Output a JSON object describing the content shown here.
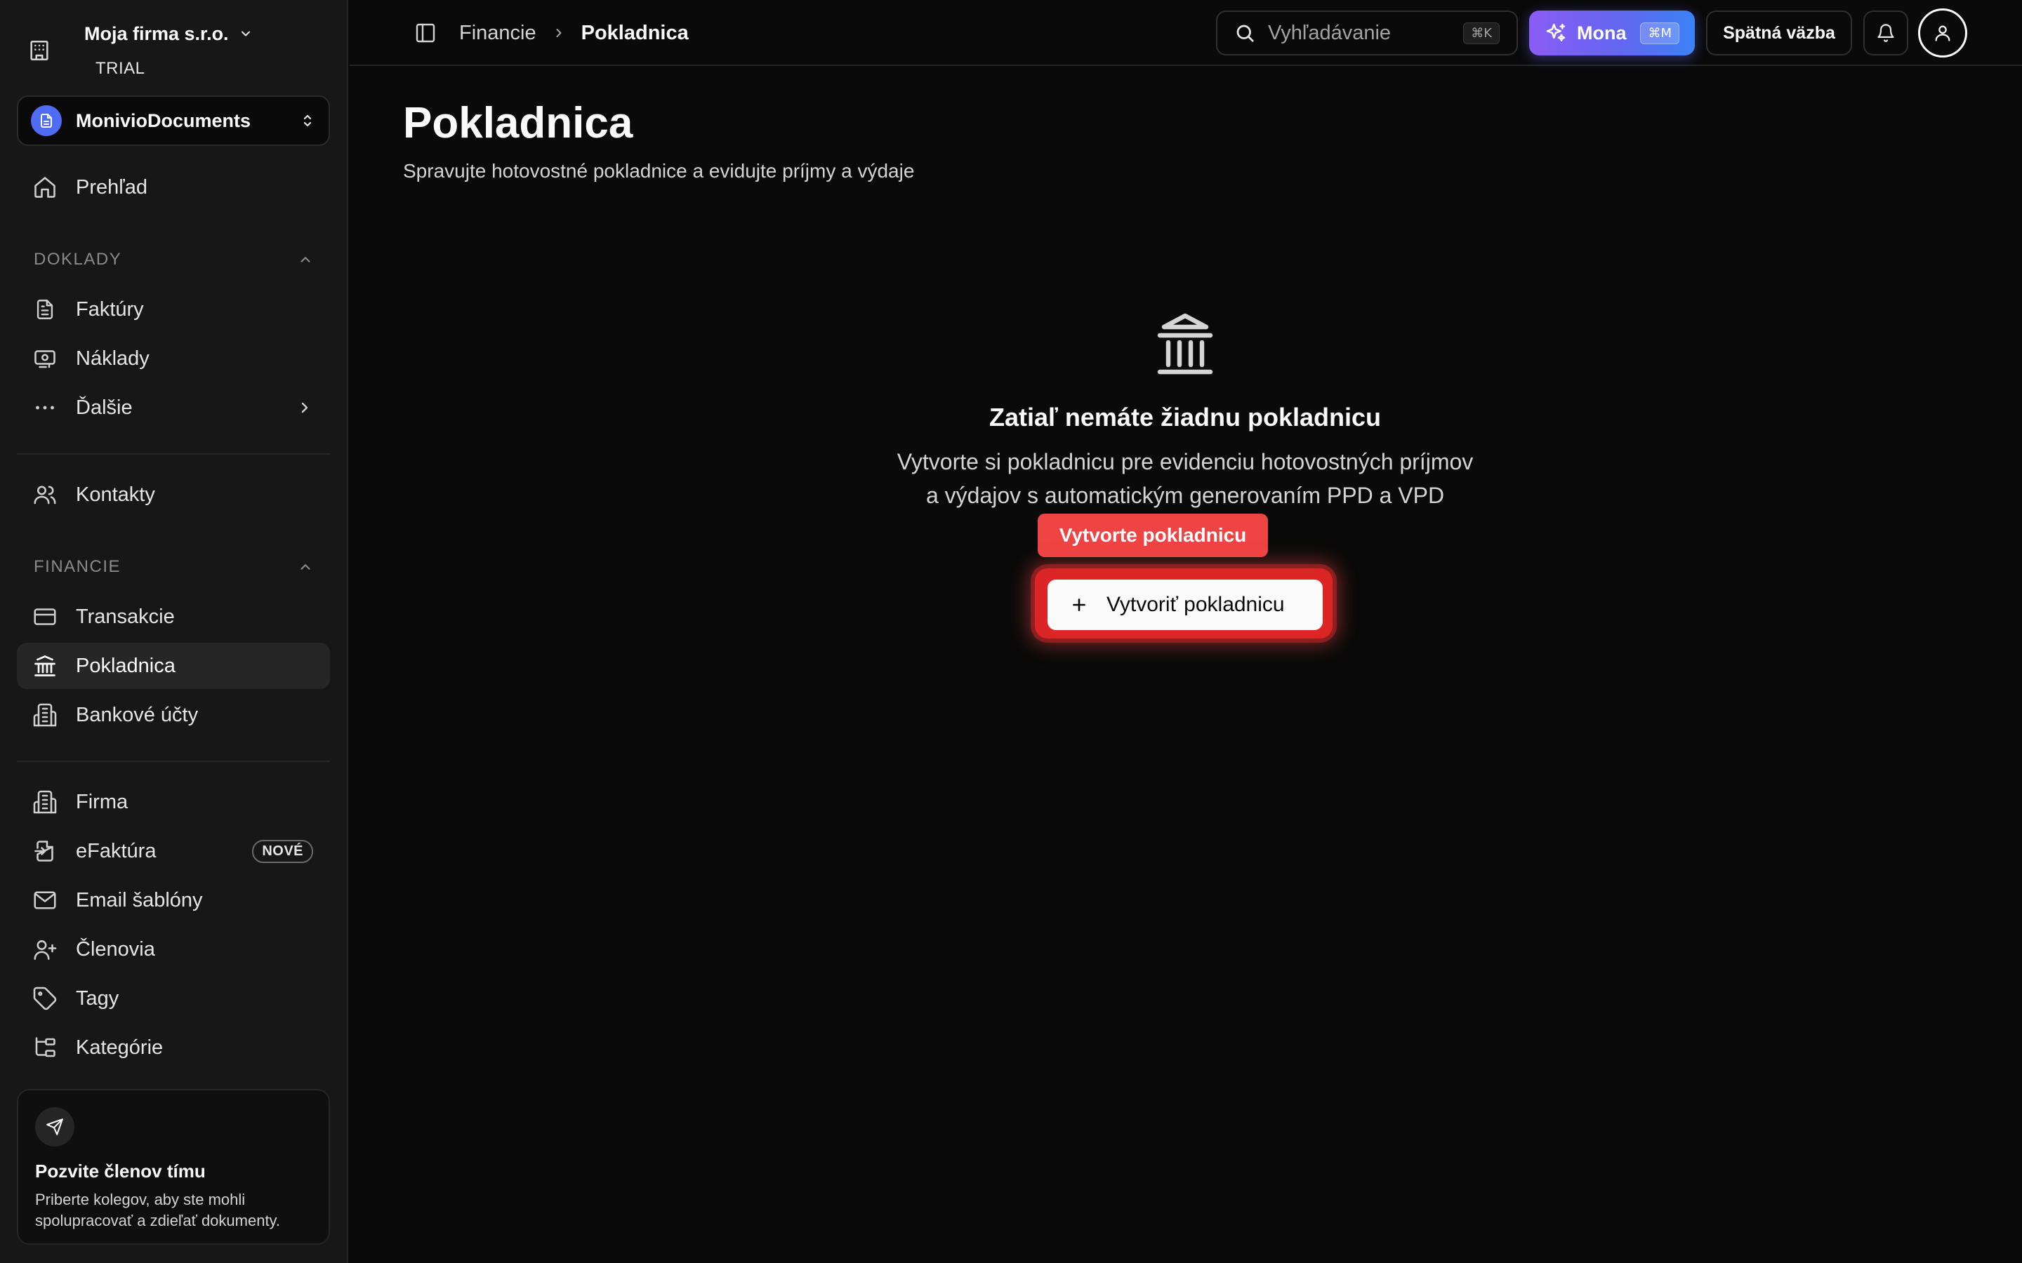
{
  "sidebar": {
    "company_name": "Moja firma s.r.o.",
    "plan_badge": "TRIAL",
    "workspace_name": "MonivioDocuments",
    "overview": "Prehľad",
    "sections": {
      "doklady": "DOKLADY",
      "financie": "FINANCIE"
    },
    "doklady_items": [
      "Faktúry",
      "Náklady",
      "Ďalšie"
    ],
    "contacts": "Kontakty",
    "financie_items": [
      "Transakcie",
      "Pokladnica",
      "Bankové účty"
    ],
    "settings_items": [
      "Firma",
      "eFaktúra",
      "Email šablóny",
      "Členovia",
      "Tagy",
      "Kategórie"
    ],
    "new_badge": "NOVÉ",
    "active_item": "Pokladnica",
    "invite": {
      "title": "Pozvite členov tímu",
      "description": "Priberte kolegov, aby ste mohli spolupracovať a zdieľať dokumenty."
    }
  },
  "topbar": {
    "breadcrumb_parent": "Financie",
    "breadcrumb_current": "Pokladnica",
    "search_placeholder": "Vyhľadávanie",
    "search_shortcut": "⌘K",
    "mona_label": "Mona",
    "mona_shortcut": "⌘M",
    "feedback_label": "Spätná väzba"
  },
  "main": {
    "title": "Pokladnica",
    "subtitle": "Spravujte hotovostné pokladnice a evidujte príjmy a výdaje",
    "empty_title": "Zatiaľ nemáte žiadnu pokladnicu",
    "empty_desc_line1": "Vytvorte si pokladnicu pre evidenciu hotovostných príjmov",
    "empty_desc_line2": "a výdajov s automatickým generovaním PPD a VPD",
    "tooltip": "Vytvorte pokladnicu",
    "cta_label": "Vytvoriť pokladnicu"
  },
  "colors": {
    "background": "#0a0a0a",
    "sidebar": "#171717",
    "accent_red": "#ef4444",
    "mona_gradient_start": "#8b5cf6",
    "mona_gradient_end": "#3b82f6",
    "workspace_icon": "#4f6cf7"
  },
  "icons": {
    "company": "building-icon",
    "workspace": "document-icon",
    "overview": "home-icon",
    "invoices": "file-text-icon",
    "costs": "receipt-icon",
    "more": "more-dots-icon",
    "contacts": "users-icon",
    "transactions": "credit-card-icon",
    "cashbox": "landmark-icon",
    "bank_accounts": "bank-building-icon",
    "firm": "building-icon",
    "efaktura": "file-export-icon",
    "email": "mail-icon",
    "members": "user-plus-icon",
    "tags": "tag-icon",
    "categories": "tree-icon",
    "invite": "send-icon"
  }
}
